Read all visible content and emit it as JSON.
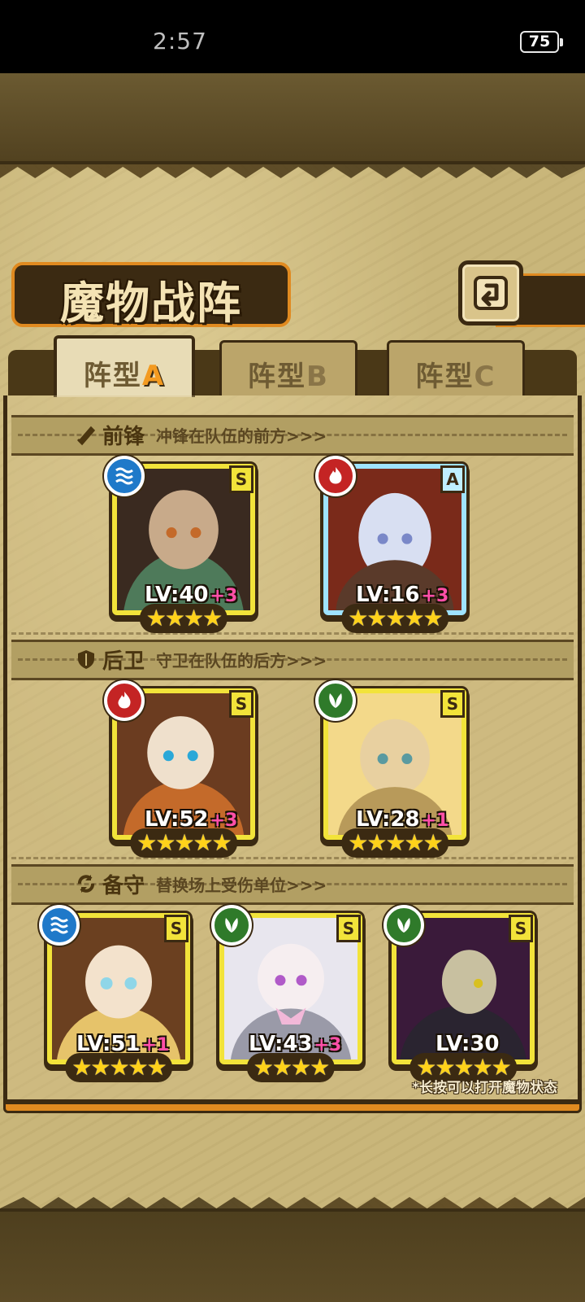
{
  "status": {
    "time": "2:57",
    "battery": "75"
  },
  "title": "魔物战阵",
  "tabs": [
    {
      "label": "阵型",
      "suffix": "A",
      "active": true
    },
    {
      "label": "阵型",
      "suffix": "B",
      "active": false
    },
    {
      "label": "阵型",
      "suffix": "C",
      "active": false
    }
  ],
  "sections": {
    "front": {
      "title": "前锋",
      "desc": "冲锋在队伍的前方>>>",
      "icon": "sword-icon"
    },
    "back": {
      "title": "后卫",
      "desc": "守卫在队伍的后方>>>",
      "icon": "shield-icon"
    },
    "reserve": {
      "title": "备守",
      "desc": "替换场上受伤单位>>>",
      "icon": "swap-icon"
    }
  },
  "monsters": {
    "front": [
      {
        "element": "water",
        "rank": "S",
        "level": "LV:40",
        "bonus": "+3",
        "stars": "★★★★",
        "colors": [
          "#3a2a20",
          "#4e7a5a",
          "#c8aa8a"
        ]
      },
      {
        "element": "fire",
        "rank": "A",
        "level": "LV:16",
        "bonus": "+3",
        "stars": "★★★★★",
        "colors": [
          "#7a2a1a",
          "#d8dff2",
          "#5a3a2a"
        ]
      }
    ],
    "back": [
      {
        "element": "fire",
        "rank": "S",
        "level": "LV:52",
        "bonus": "+3",
        "stars": "★★★★★",
        "colors": [
          "#6b3c20",
          "#c46a2a",
          "#efe0cc"
        ]
      },
      {
        "element": "grass",
        "rank": "S",
        "level": "LV:28",
        "bonus": "+1",
        "stars": "★★★★★",
        "colors": [
          "#f3d98a",
          "#e8d0a0",
          "#b89a5a"
        ]
      }
    ],
    "reserve": [
      {
        "element": "water",
        "rank": "S",
        "level": "LV:51",
        "bonus": "+1",
        "stars": "★★★★★",
        "colors": [
          "#6b4020",
          "#e6c36a",
          "#8fd6e8"
        ]
      },
      {
        "element": "grass",
        "rank": "S",
        "level": "LV:43",
        "bonus": "+3",
        "stars": "★★★★",
        "colors": [
          "#e8e6ee",
          "#f2b8d8",
          "#9a9aa8"
        ]
      },
      {
        "element": "grass",
        "rank": "S",
        "level": "LV:30",
        "bonus": "",
        "stars": "★★★★★",
        "colors": [
          "#3a1a3a",
          "#2a2430",
          "#c8c0a0"
        ]
      }
    ]
  },
  "hint": "*长按可以打开魔物状态"
}
